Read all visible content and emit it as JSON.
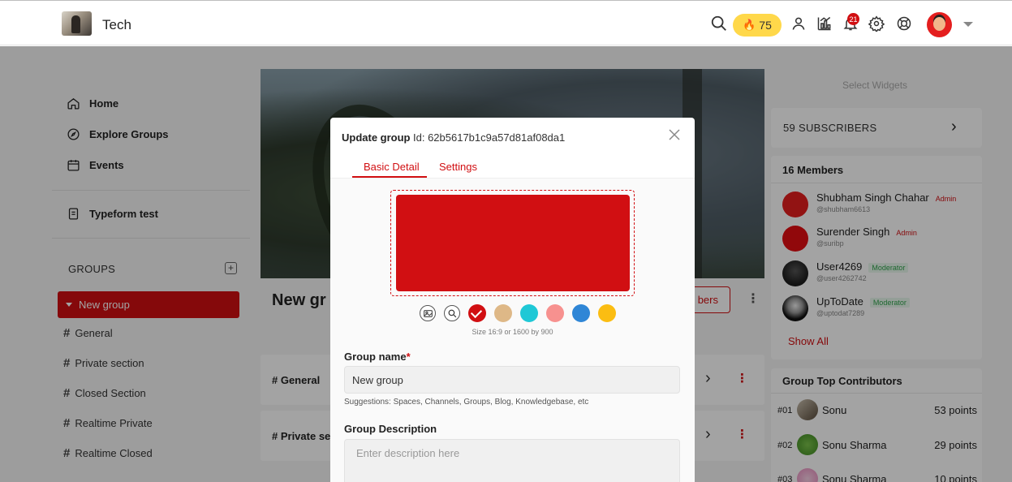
{
  "header": {
    "brand": "Tech",
    "streak_count": "75",
    "notification_count": "21"
  },
  "sidebar": {
    "nav": [
      {
        "label": "Home",
        "icon": "home-icon"
      },
      {
        "label": "Explore Groups",
        "icon": "compass-icon"
      },
      {
        "label": "Events",
        "icon": "calendar-icon"
      },
      {
        "label": "Typeform test",
        "icon": "form-icon"
      }
    ],
    "groups_heading": "GROUPS",
    "active_group": "New group",
    "channels": [
      "General",
      "Private section",
      "Closed Section",
      "Realtime Private",
      "Realtime Closed"
    ]
  },
  "main": {
    "group_title_partial": "New gr",
    "members_button_partial": "bers",
    "channel_cards": [
      "# General",
      "# Private sec"
    ]
  },
  "right": {
    "widgets_hint": "Select Widgets",
    "subscribers": "59 SUBSCRIBERS",
    "members_title": "16 Members",
    "members": [
      {
        "name": "Shubham Singh Chahar",
        "handle": "@shubham6613",
        "role": "Admin"
      },
      {
        "name": "Surender Singh",
        "handle": "@suribp",
        "role": "Admin"
      },
      {
        "name": "User4269",
        "handle": "@user4262742",
        "role": "Moderator"
      },
      {
        "name": "UpToDate",
        "handle": "@uptodat7289",
        "role": "Moderator"
      }
    ],
    "show_all": "Show All",
    "contributors_title": "Group Top Contributors",
    "contributors": [
      {
        "rank": "#01",
        "name": "Sonu",
        "points": "53 points"
      },
      {
        "rank": "#02",
        "name": "Sonu Sharma",
        "points": "29 points"
      },
      {
        "rank": "#03",
        "name": "Sonu Sharma",
        "points": "10 points"
      }
    ]
  },
  "modal": {
    "title": "Update group",
    "id_text": "Id: 62b5617b1c9a57d81af08da1",
    "tabs": [
      "Basic Detail",
      "Settings"
    ],
    "cover_color": "#d10f12",
    "swatch_colors": [
      "#d10f12",
      "#deb887",
      "#1fc8d6",
      "#f7918f",
      "#2f86d6",
      "#fbbd12"
    ],
    "size_note": "Size 16:9 or 1600 by 900",
    "name_label": "Group name",
    "name_required": "*",
    "name_value": "New group",
    "name_hint": "Suggestions: Spaces, Channels, Groups, Blog, Knowledgebase, etc",
    "desc_label": "Group Description",
    "desc_placeholder": "Enter description here"
  },
  "colors": {
    "brand_red": "#d10f12",
    "streak_yellow": "#ffd84a",
    "moderator_green": "#2fa34b"
  }
}
